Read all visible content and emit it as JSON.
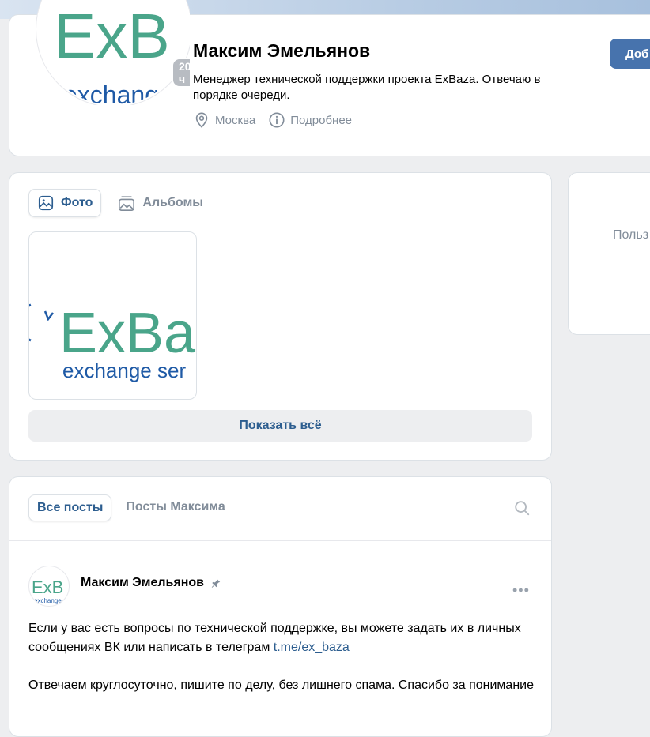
{
  "profile": {
    "name": "Максим Эмельянов",
    "status": "Менеджер технической поддержки проекта ExBaza. Отвечаю в порядке очереди.",
    "city": "Москва",
    "details_label": "Подробнее",
    "online_badge": "20 ч",
    "add_button_label": "Доб",
    "avatar_logo_main": "ExB",
    "avatar_logo_sub": "exchang"
  },
  "photos": {
    "tabs": [
      {
        "label": "Фото",
        "icon": "image-icon",
        "active": true
      },
      {
        "label": "Альбомы",
        "icon": "albums-icon",
        "active": false
      }
    ],
    "thumb_logo_main": "ExBa",
    "thumb_logo_sub": "exchange ser",
    "show_all_label": "Показать всё"
  },
  "side": {
    "text": "Польз"
  },
  "posts": {
    "tabs": [
      {
        "label": "Все посты",
        "active": true
      },
      {
        "label": "Посты Максима",
        "active": false
      }
    ],
    "post": {
      "author": "Максим Эмельянов",
      "avatar_logo_main": "ExB",
      "avatar_logo_sub": "exchange",
      "paragraph1_text": "Если у вас есть вопросы по технической поддержке, вы можете задать их в личных сообщениях ВК или написать в телеграм ",
      "paragraph1_link": "t.me/ex_baza",
      "paragraph2": "Отвечаем круглосуточно, пишите по делу, без лишнего спама. Спасибо за понимание"
    }
  },
  "colors": {
    "accent": "#2c5d8f",
    "button": "#4773ad",
    "logo_green": "#4aa58a",
    "logo_blue": "#1f5aa6"
  }
}
